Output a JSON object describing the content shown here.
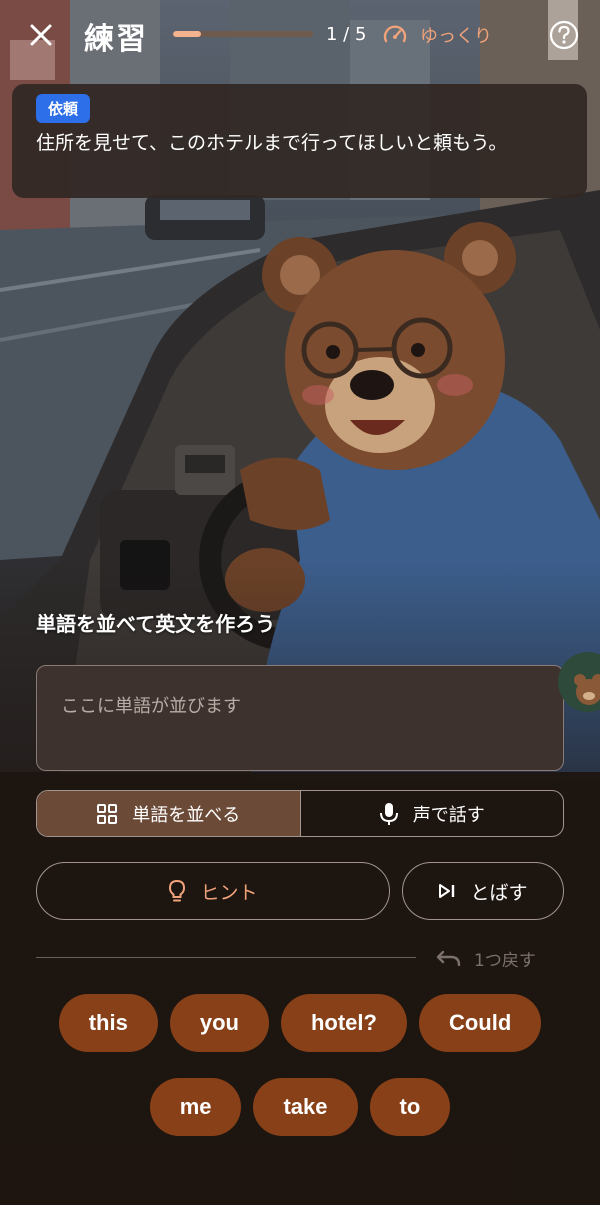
{
  "header": {
    "title": "練習",
    "progress_text": "1 / 5",
    "progress_fraction": 0.2,
    "speed_label": "ゆっくり"
  },
  "request": {
    "badge": "依頼",
    "text": "住所を見せて、このホテルまで行ってほしいと頼もう。"
  },
  "task": {
    "instruction": "単語を並べて英文を作ろう",
    "answer_placeholder": "ここに単語が並びます"
  },
  "modes": {
    "arrange_label": "単語を並べる",
    "voice_label": "声で話す"
  },
  "actions": {
    "hint_label": "ヒント",
    "skip_label": "とばす",
    "undo_label": "1つ戻す"
  },
  "chips": {
    "row1": [
      "this",
      "you",
      "hotel?",
      "Could"
    ],
    "row2": [
      "me",
      "take",
      "to"
    ]
  },
  "colors": {
    "accent_orange": "#f0a27a",
    "chip_brown": "#874017",
    "badge_blue": "#2c6fe8"
  }
}
